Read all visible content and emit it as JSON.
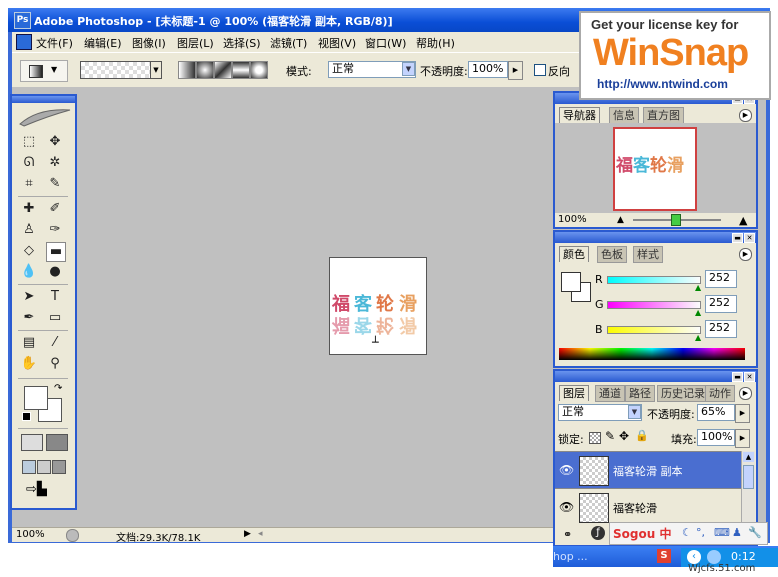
{
  "window": {
    "title": "Adobe Photoshop - [未标题-1 @ 100% (福客轮滑 副本, RGB/8)]"
  },
  "menu": {
    "items": [
      "文件(F)",
      "编辑(E)",
      "图像(I)",
      "图层(L)",
      "选择(S)",
      "滤镜(T)",
      "视图(V)",
      "窗口(W)",
      "帮助(H)"
    ]
  },
  "options": {
    "mode_label": "模式:",
    "mode_value": "正常",
    "opacity_label": "不透明度:",
    "opacity_value": "100%",
    "reverse_label": "反向"
  },
  "canvas": {
    "text_top": [
      "福",
      "客",
      "轮",
      "滑"
    ],
    "text_colors": [
      "#d04a6a",
      "#4ab8d8",
      "#e07848",
      "#e8a060"
    ]
  },
  "statusbar": {
    "zoom": "100%",
    "doc_info": "文档:29.3K/78.1K"
  },
  "navigator": {
    "tabs": [
      "导航器",
      "信息",
      "直方图"
    ],
    "zoom": "100%"
  },
  "color": {
    "tabs": [
      "颜色",
      "色板",
      "样式"
    ],
    "r_label": "R",
    "g_label": "G",
    "b_label": "B",
    "r_value": "252",
    "g_value": "252",
    "b_value": "252"
  },
  "layers": {
    "tabs": [
      "图层",
      "通道",
      "路径",
      "历史记录",
      "动作"
    ],
    "blend": "正常",
    "opacity_label": "不透明度:",
    "opacity_value": "65%",
    "lock_label": "锁定:",
    "fill_label": "填充:",
    "fill_value": "100%",
    "items": [
      {
        "name": "福客轮滑 副本",
        "selected": true
      },
      {
        "name": "福客轮滑",
        "selected": false
      }
    ]
  },
  "winsnap": {
    "line1": "Get your license key for",
    "logo": "WinSnap",
    "url": "http://www.ntwind.com"
  },
  "taskbar": {
    "item": "hop ...",
    "ime": "Sogou 中",
    "clock": "0:12"
  },
  "credit": "Wjcfs.51.com"
}
